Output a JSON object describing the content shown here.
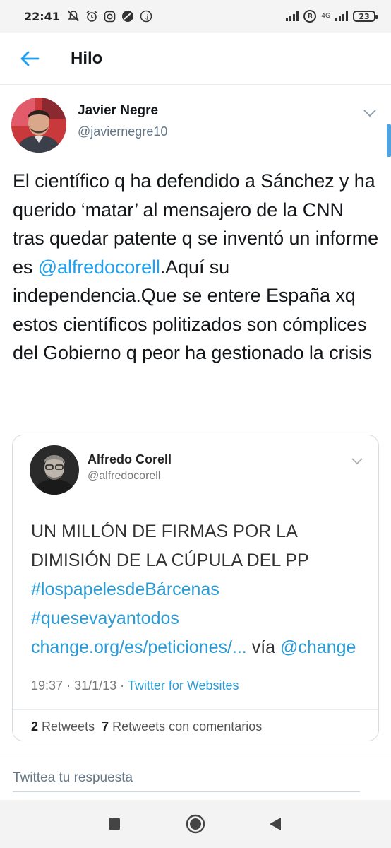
{
  "status_bar": {
    "time": "22:41",
    "left_icons": [
      "notifications-off-icon",
      "alarm-icon",
      "instagram-icon",
      "app-icon",
      "tj-icon"
    ],
    "network_label": "4G",
    "battery": "23",
    "r_badge": "R"
  },
  "header": {
    "title": "Hilo",
    "accent_color": "#1da1f2"
  },
  "tweet": {
    "author_name": "Javier Negre",
    "author_handle": "@javiernegre10",
    "text_before": "El científico q ha defendido a Sánchez y ha querido ‘matar’ al mensajero de la CNN tras quedar patente q se inventó un informe es ",
    "mention": "@alfredocorell",
    "text_after": ".Aquí su independencia.Que se entere España xq estos científicos politizados son cómplices del Gobierno q peor ha gestionado la crisis"
  },
  "quoted_tweet": {
    "author_name": "Alfredo Corell",
    "author_handle": "@alfredocorell",
    "text_main": "UN MILLÓN DE FIRMAS POR LA DIMISIÓN DE LA CÚPULA DEL PP",
    "hashtag1": "#lospapelesdeBárcenas",
    "hashtag2": "#quesevayantodos",
    "link": "change.org/es/peticiones/...",
    "via": "vía",
    "via_mention": "@change",
    "time": "19:37",
    "date": "31/1/13",
    "separator": "·",
    "source": "Twitter for Websites",
    "retweets_count": "2",
    "retweets_label": "Retweets",
    "quotes_count": "7",
    "quotes_label": "Retweets con comentarios"
  },
  "reply": {
    "placeholder": "Twittea tu respuesta"
  },
  "nav": {
    "buttons": [
      "recents-button",
      "home-button",
      "back-button"
    ]
  }
}
